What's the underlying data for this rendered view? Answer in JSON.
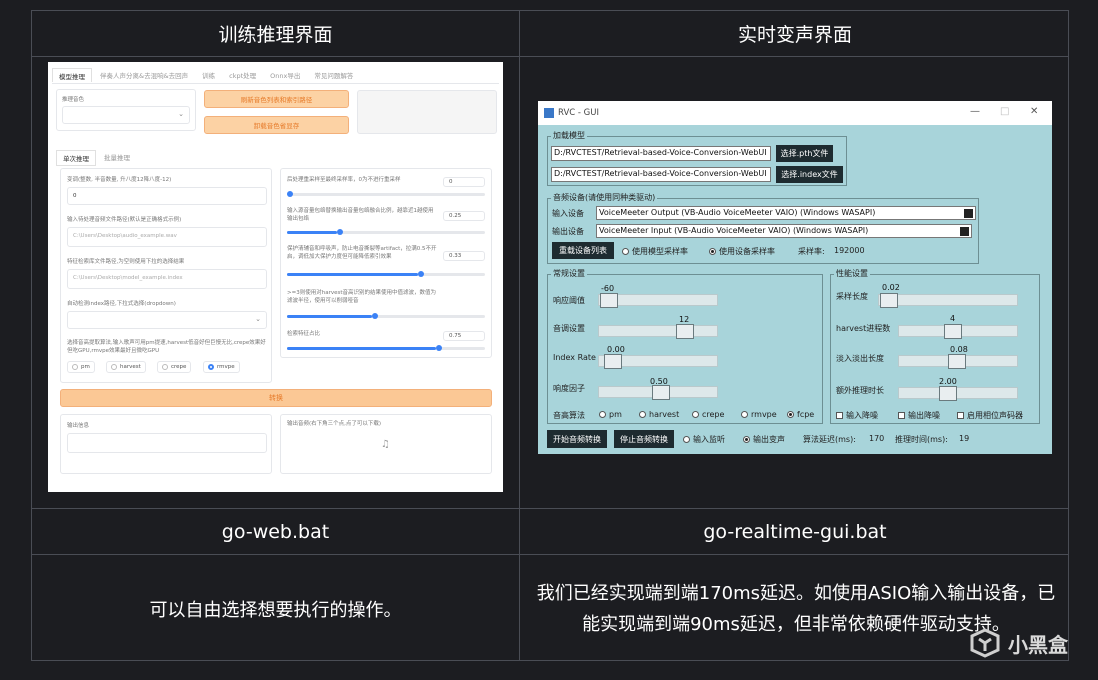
{
  "header": {
    "left": "训练推理界面",
    "right": "实时变声界面"
  },
  "files": {
    "left": "go-web.bat",
    "right": "go-realtime-gui.bat"
  },
  "desc": {
    "left": "可以自由选择想要执行的操作。",
    "right": "我们已经实现端到端170ms延迟。如使用ASIO输入输出设备，已能实现端到端90ms延迟，但非常依赖硬件驱动支持。"
  },
  "watermark": {
    "text": "小黑盒"
  },
  "webui": {
    "tabs": [
      "模型推理",
      "伴奏人声分离&去混响&去回声",
      "训练",
      "ckpt处理",
      "Onnx导出",
      "常见问题解答"
    ],
    "voice_label": "推理音色",
    "refresh_btn": "刷新音色列表和索引路径",
    "unload_btn": "卸载音色省显存",
    "subtabs": [
      "单次推理",
      "批量推理"
    ],
    "transpose_label": "变调(整数, 半音数量, 升八度12降八度-12)",
    "transpose_value": "0",
    "input_path_label": "输入待处理音频文件路径(默认是正确格式示例)",
    "input_path_placeholder": "C:\\Users\\Desktop\\audio_example.wav",
    "index_label": "特征检索库文件路径,为空则使用下拉的选择结果",
    "index_placeholder": "C:\\Users\\Desktop\\model_example.index",
    "auto_index_label": "自动检测index路径,下拉式选择(dropdown)",
    "f0_label": "选择音高提取算法,输入歌声可用pm提速,harvest低音好但巨慢无比,crepe效果好但吃GPU,rmvpe效果最好且微吃GPU",
    "f0_options": [
      "pm",
      "harvest",
      "crepe",
      "rmvpe"
    ],
    "f0_selected": "rmvpe",
    "resample_label": "后处理重采样至最终采样率，0为不进行重采样",
    "resample_value": "0",
    "index_rate_label": "输入源音量包络替换输出音量包络融合比例，越靠近1越使用输出包络",
    "index_rate_value": "0.25",
    "protect_label": "保护清辅音和呼吸声，防止电音撕裂等artifact，拉满0.5不开启，调低加大保护力度但可能降低索引效果",
    "protect_value": "0.33",
    "filter_label": ">=3则使用对harvest音高识别的结果使用中值滤波，数值为滤波半径，使用可以削弱哑音",
    "feature_label": "检索特征占比",
    "feature_value": "0.75",
    "convert_btn": "转换",
    "output_info_label": "输出信息",
    "output_audio_label": "输出音频(右下角三个点,点了可以下载)",
    "music_icon": "music-note-icon"
  },
  "gui": {
    "title": "RVC - GUI",
    "load_model": "加载模型",
    "pth_path": "D:/RVCTEST/Retrieval-based-Voice-Conversion-WebUI",
    "index_path": "D:/RVCTEST/Retrieval-based-Voice-Conversion-WebUI",
    "select_pth": "选择.pth文件",
    "select_index": "选择.index文件",
    "audio_device": "音频设备(请使用同种类驱动)",
    "input_label": "输入设备",
    "input_value": "VoiceMeeter Output (VB-Audio VoiceMeeter VAIO) (Windows WASAPI)",
    "output_label": "输出设备",
    "output_value": "VoiceMeeter Input (VB-Audio VoiceMeeter VAIO) (Windows WASAPI)",
    "reload_btn": "重载设备列表",
    "use_model_sr": "使用模型采样率",
    "use_device_sr": "使用设备采样率",
    "sr_label": "采样率:",
    "sr_value": "192000",
    "general": "常规设置",
    "response_label": "响应阈值",
    "response_value": "-60",
    "pitch_label": "音调设置",
    "pitch_value": "12",
    "index_rate_label": "Index Rate",
    "index_rate_value": "0.00",
    "rms_label": "响度因子",
    "rms_value": "0.50",
    "f0_label": "音高算法",
    "f0_options": [
      "pm",
      "harvest",
      "crepe",
      "rmvpe",
      "fcpe"
    ],
    "f0_selected": "fcpe",
    "perf": "性能设置",
    "sample_len_label": "采样长度",
    "sample_len_value": "0.02",
    "harvest_label": "harvest进程数",
    "harvest_value": "4",
    "fade_label": "淡入淡出长度",
    "fade_value": "0.08",
    "extra_label": "额外推理时长",
    "extra_value": "2.00",
    "checks": [
      "输入降噪",
      "输出降噪",
      "启用相位声码器"
    ],
    "start_btn": "开始音频转换",
    "stop_btn": "停止音频转换",
    "input_monitor": "输入监听",
    "output_voice": "输出变声",
    "delay_label": "算法延迟(ms):",
    "delay_value": "170",
    "infer_label": "推理时间(ms):",
    "infer_value": "19"
  }
}
